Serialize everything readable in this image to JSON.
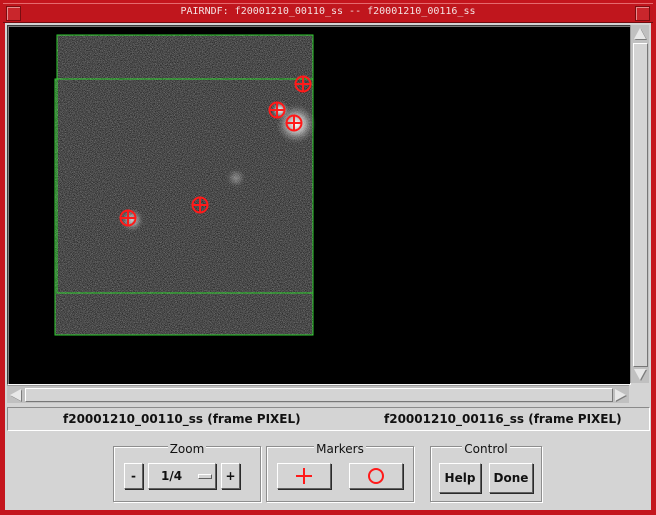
{
  "window": {
    "title": "PAIRNDF: f20001210_00110_ss -- f20001210_00116_ss"
  },
  "frames": {
    "left_label": "f20001210_00110_ss (frame PIXEL)",
    "right_label": "f20001210_00116_ss (frame PIXEL)"
  },
  "zoom": {
    "title": "Zoom",
    "minus_label": "-",
    "value": "1/4",
    "plus_label": "+"
  },
  "markers": {
    "title": "Markers",
    "cross_icon": "plus-marker-icon",
    "circle_icon": "circle-marker-icon"
  },
  "control": {
    "title": "Control",
    "help_label": "Help",
    "done_label": "Done"
  },
  "colors": {
    "frame_border": "#e02a2a",
    "marker_red": "#ff1a1a",
    "overlay_green": "#2fd12f",
    "panel_gray": "#d4d4d4"
  }
}
